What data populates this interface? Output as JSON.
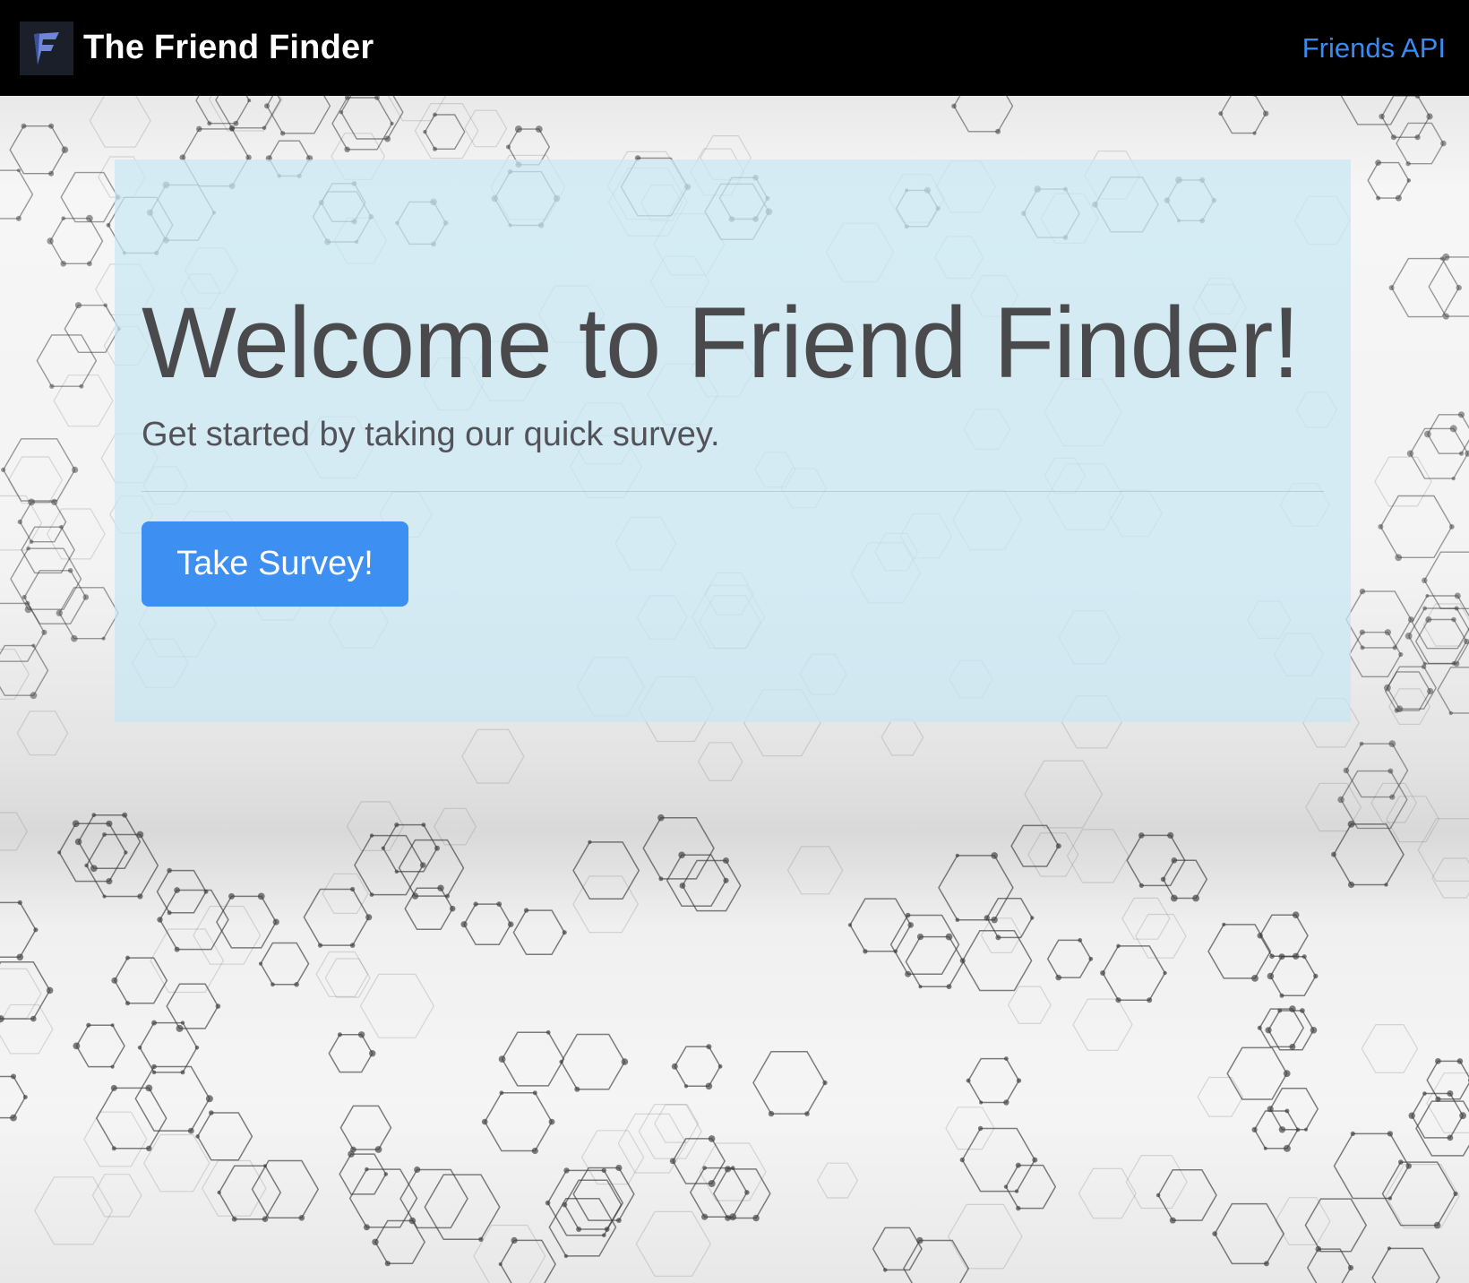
{
  "navbar": {
    "brand_text": "The Friend Finder",
    "logo_icon": "friend-finder-logo-icon",
    "api_link": "Friends API"
  },
  "jumbotron": {
    "title": "Welcome to Friend Finder!",
    "lead": "Get started by taking our quick survey.",
    "button_label": "Take Survey!"
  },
  "colors": {
    "navbar_bg": "#000000",
    "link": "#3a8bf0",
    "button": "#3d8ff2",
    "jumbotron_bg": "#c7e8f4"
  },
  "background": {
    "pattern_icon": "hexagon-network-pattern"
  }
}
